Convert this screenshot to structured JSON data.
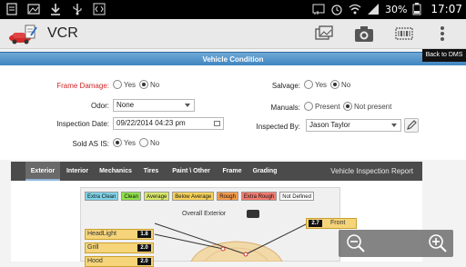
{
  "status_bar": {
    "battery": "30%",
    "time": "17:07",
    "icons": [
      "notes-icon",
      "image-icon",
      "download-icon",
      "usb-icon",
      "code-icon",
      "cast-icon",
      "alarm-icon",
      "wifi-icon",
      "signal-icon",
      "battery-icon"
    ]
  },
  "action_bar": {
    "title": "VCR",
    "icons": [
      "gallery-icon",
      "camera-icon",
      "scan-icon",
      "overflow-menu-icon"
    ]
  },
  "back_link": "Back to DMS",
  "section_title": "Vehicle Condition",
  "form": {
    "frame_damage": {
      "label": "Frame Damage:",
      "options": [
        "Yes",
        "No"
      ],
      "selected": "No"
    },
    "odor": {
      "label": "Odor:",
      "value": "None"
    },
    "inspection_date": {
      "label": "Inspection Date:",
      "value": "09/22/2014 04:23 pm"
    },
    "sold_as_is": {
      "label": "Sold AS IS:",
      "options": [
        "Yes",
        "No"
      ],
      "selected": "Yes"
    },
    "salvage": {
      "label": "Salvage:",
      "options": [
        "Yes",
        "No"
      ],
      "selected": "No"
    },
    "manuals": {
      "label": "Manuals:",
      "options": [
        "Present",
        "Not present"
      ],
      "selected": "Not present"
    },
    "inspected_by": {
      "label": "Inspected By:",
      "value": "Jason Taylor"
    }
  },
  "tabs": [
    "Exterior",
    "Interior",
    "Mechanics",
    "Tires",
    "Paint \\ Other",
    "Frame",
    "Grading"
  ],
  "active_tab": "Exterior",
  "report_title": "Vehicle Inspection Report",
  "legend": [
    {
      "label": "Extra Clean",
      "color": "#7fd3e8"
    },
    {
      "label": "Clean",
      "color": "#8fe04a"
    },
    {
      "label": "Average",
      "color": "#d8e86a"
    },
    {
      "label": "Below Average",
      "color": "#f7d25a"
    },
    {
      "label": "Rough",
      "color": "#f59a4a"
    },
    {
      "label": "Extra Rough",
      "color": "#f27a6e"
    },
    {
      "label": "Not Defined",
      "color": "#ffffff"
    }
  ],
  "overall_label": "Overall Exterior",
  "ratings": [
    {
      "label": "HeadLight",
      "value": "1.8"
    },
    {
      "label": "Grill",
      "value": "2.0"
    },
    {
      "label": "Hood",
      "value": "2.0"
    }
  ],
  "front": {
    "label": "Front",
    "value": "2.7"
  },
  "colors": {
    "header_blue": "#3f85c0",
    "tab_bar": "#4b4b4b",
    "rating_yellow": "#f5d47a"
  }
}
